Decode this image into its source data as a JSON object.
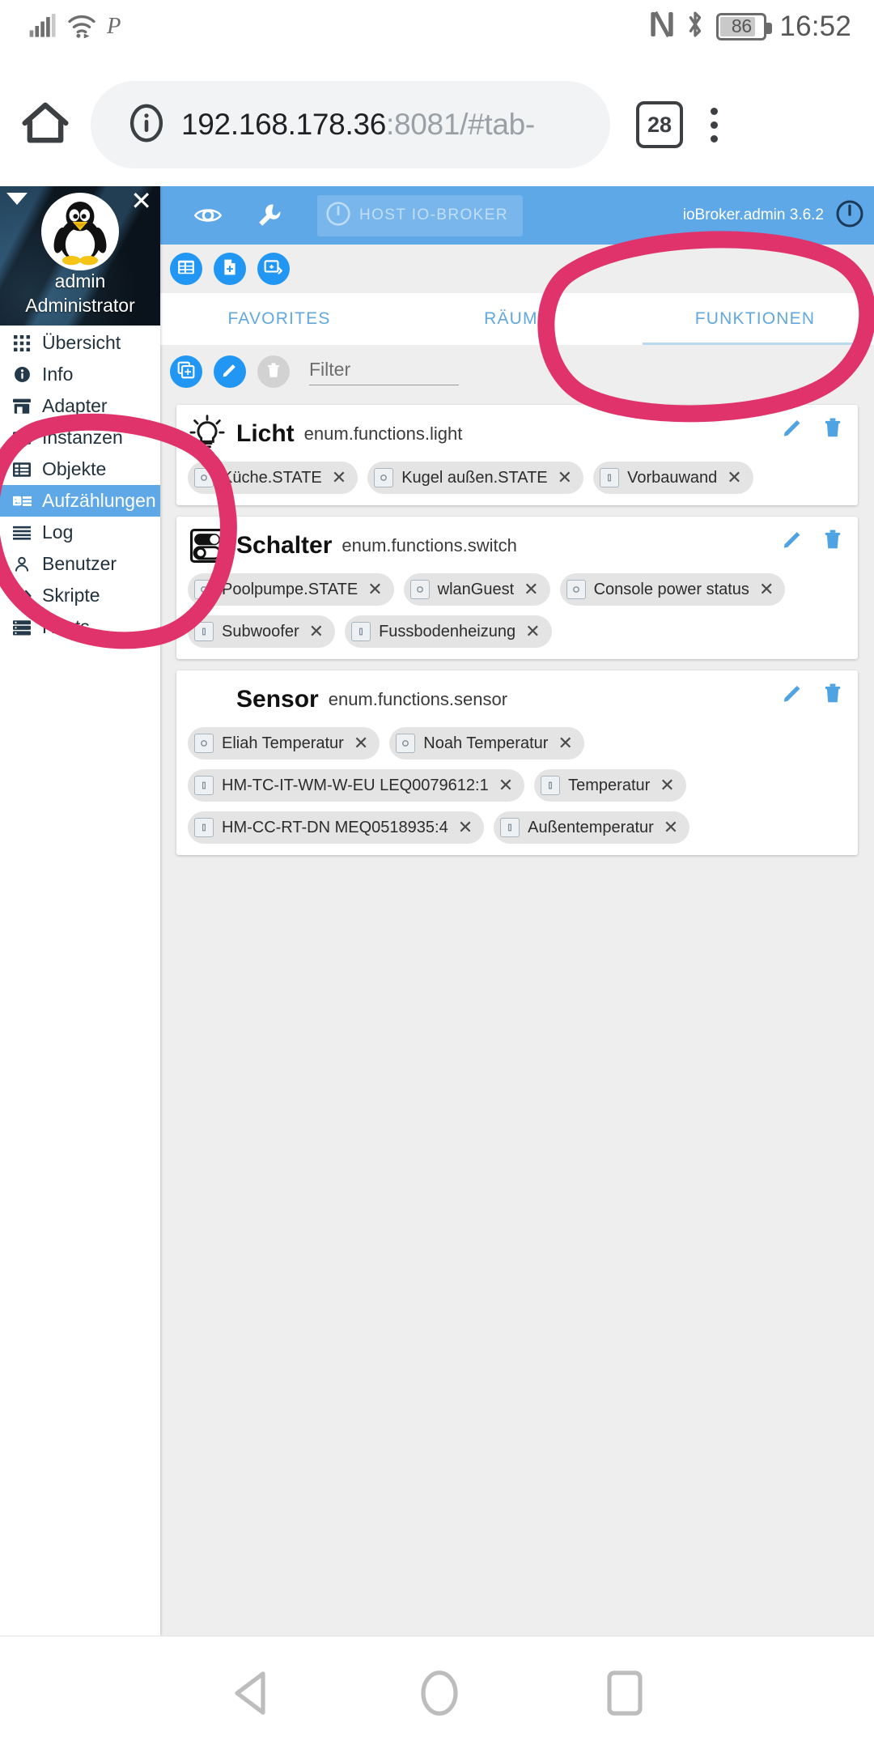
{
  "status_bar": {
    "signal_icon": "cellular-signal-icon",
    "wifi_icon": "wifi-icon",
    "pandora_icon": "pandora-p-icon",
    "nfc_icon": "nfc-icon",
    "bluetooth_icon": "bluetooth-icon",
    "battery_icon": "battery-icon",
    "battery_level": "86",
    "clock": "16:52"
  },
  "browser": {
    "home_icon": "home-icon",
    "info_icon": "site-info-icon",
    "url_host": "192.168.178.36",
    "url_rest": ":8081/#tab-",
    "tab_count": "28",
    "menu_icon": "overflow-menu-icon"
  },
  "sidebar": {
    "caret_icon": "caret-down-icon",
    "close_icon": "close-icon",
    "avatar_icon": "tux-penguin-avatar",
    "user": "admin",
    "role": "Administrator",
    "items": [
      {
        "label": "Übersicht",
        "icon": "grid-icon",
        "active": false
      },
      {
        "label": "Info",
        "icon": "info-icon",
        "active": false
      },
      {
        "label": "Adapter",
        "icon": "store-icon",
        "active": false
      },
      {
        "label": "Instanzen",
        "icon": "instances-icon",
        "active": false
      },
      {
        "label": "Objekte",
        "icon": "list-alt-icon",
        "active": false
      },
      {
        "label": "Aufzählungen",
        "icon": "enums-icon",
        "active": true
      },
      {
        "label": "Log",
        "icon": "log-lines-icon",
        "active": false
      },
      {
        "label": "Benutzer",
        "icon": "person-icon",
        "active": false
      },
      {
        "label": "Skripte",
        "icon": "code-icon",
        "active": false
      },
      {
        "label": "Hosts",
        "icon": "server-icon",
        "active": false
      }
    ]
  },
  "toolbar": {
    "eye_icon": "eye-icon",
    "wrench_icon": "wrench-icon",
    "host_button_label": "HOST IO-BROKER",
    "host_power_icon": "power-icon",
    "version": "ioBroker.admin 3.6.2",
    "logout_icon": "power-icon"
  },
  "subbar": {
    "buttons": [
      {
        "name": "list-view-button",
        "icon": "list-icon"
      },
      {
        "name": "new-file-button",
        "icon": "file-add-icon"
      },
      {
        "name": "add-group-button",
        "icon": "add-to-collection-icon"
      }
    ]
  },
  "tabs": [
    {
      "label": "FAVORITES",
      "active": false
    },
    {
      "label": "RÄUME",
      "active": false
    },
    {
      "label": "FUNKTIONEN",
      "active": true
    }
  ],
  "filter_row": {
    "add_button_icon": "add-copy-icon",
    "edit_button_icon": "pencil-icon",
    "delete_button_icon": "trash-icon",
    "filter_placeholder": "Filter",
    "filter_value": ""
  },
  "cards": [
    {
      "title": "Licht",
      "subtitle": "enum.functions.light",
      "icon": "lightbulb-icon",
      "edit_icon": "pencil-icon",
      "delete_icon": "trash-icon",
      "members": [
        {
          "label": "Küche.STATE",
          "icon": "state-icon"
        },
        {
          "label": "Kugel außen.STATE",
          "icon": "state-icon"
        },
        {
          "label": "Vorbauwand",
          "icon": "channel-icon"
        }
      ]
    },
    {
      "title": "Schalter",
      "subtitle": "enum.functions.switch",
      "icon": "toggle-switch-icon",
      "edit_icon": "pencil-icon",
      "delete_icon": "trash-icon",
      "members": [
        {
          "label": "Poolpumpe.STATE",
          "icon": "state-icon"
        },
        {
          "label": "wlanGuest",
          "icon": "state-icon"
        },
        {
          "label": "Console power status",
          "icon": "state-icon"
        },
        {
          "label": "Subwoofer",
          "icon": "channel-icon"
        },
        {
          "label": "Fussbodenheizung",
          "icon": "channel-icon"
        }
      ]
    },
    {
      "title": "Sensor",
      "subtitle": "enum.functions.sensor",
      "icon": "none",
      "edit_icon": "pencil-icon",
      "delete_icon": "trash-icon",
      "members": [
        {
          "label": "Eliah Temperatur",
          "icon": "state-icon"
        },
        {
          "label": "Noah Temperatur",
          "icon": "state-icon"
        },
        {
          "label": "HM-TC-IT-WM-W-EU LEQ0079612:1",
          "icon": "channel-icon"
        },
        {
          "label": "Temperatur",
          "icon": "channel-icon"
        },
        {
          "label": "HM-CC-RT-DN MEQ0518935:4",
          "icon": "channel-icon"
        },
        {
          "label": "Außentemperatur",
          "icon": "channel-icon"
        }
      ]
    }
  ],
  "annotations": {
    "marker_color": "#e0336b",
    "circles": [
      {
        "name": "funktionen-tab-highlight"
      },
      {
        "name": "sidebar-enums-highlight"
      }
    ]
  },
  "nav_bar": {
    "back_icon": "back-triangle-icon",
    "home_icon": "home-circle-icon",
    "recents_icon": "recents-square-icon"
  },
  "colors": {
    "accent_blue": "#5fa8e8",
    "button_blue": "#2196f3",
    "page_bg": "#eeeeee",
    "marker_pink": "#e0336b"
  }
}
